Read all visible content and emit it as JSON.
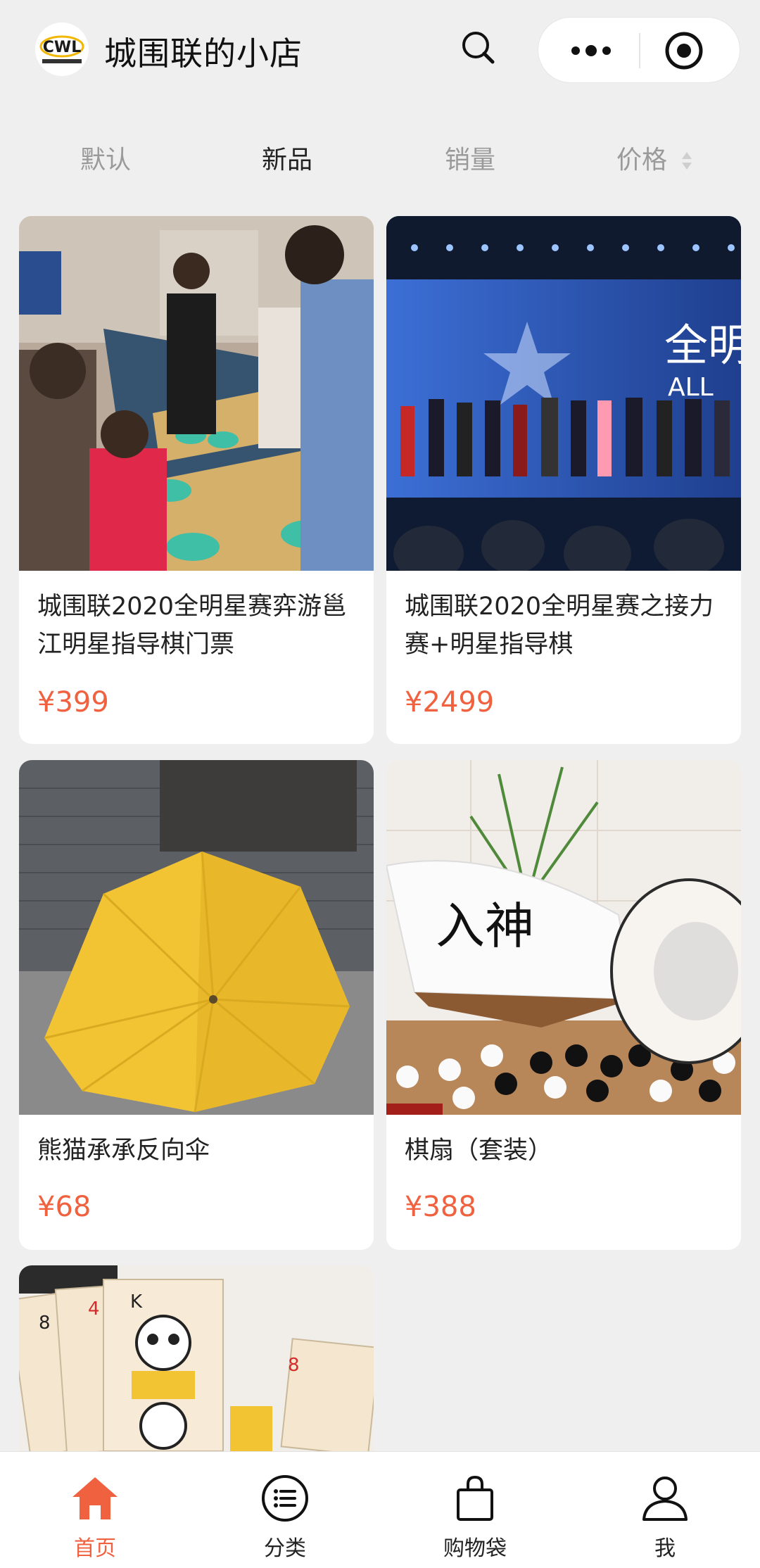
{
  "header": {
    "title": "城围联的小店",
    "logo_text": "CWL"
  },
  "sort": {
    "tabs": [
      {
        "label": "默认",
        "active": false
      },
      {
        "label": "新品",
        "active": true
      },
      {
        "label": "销量",
        "active": false
      },
      {
        "label": "价格",
        "active": false
      }
    ]
  },
  "products": [
    {
      "name": "城围联2020全明星赛弈游邕江明星指导棋门票",
      "price": "¥399",
      "image": "players-at-go-boards"
    },
    {
      "name": "城围联2020全明星赛之接力赛+明星指导棋",
      "price": "¥2499",
      "image": "awards-ceremony-stage",
      "stage_text": "全明",
      "stage_text2": "ALL"
    },
    {
      "name": "熊猫承承反向伞",
      "price": "¥68",
      "image": "yellow-umbrella"
    },
    {
      "name": "棋扇（套装）",
      "price": "¥388",
      "image": "go-fan-set",
      "fan_text": "入神"
    },
    {
      "name": "",
      "price": "",
      "image": "panda-playing-cards"
    }
  ],
  "tabbar": {
    "items": [
      {
        "label": "首页",
        "icon": "home-icon",
        "active": true
      },
      {
        "label": "分类",
        "icon": "list-icon",
        "active": false
      },
      {
        "label": "购物袋",
        "icon": "bag-icon",
        "active": false
      },
      {
        "label": "我",
        "icon": "user-icon",
        "active": false
      }
    ]
  },
  "colors": {
    "accent": "#f0613f",
    "background": "#efefef"
  }
}
